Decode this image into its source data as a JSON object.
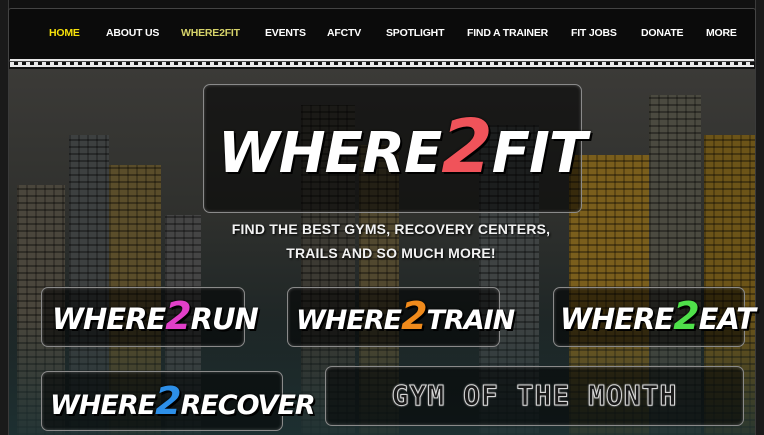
{
  "nav": {
    "items": [
      {
        "label": "HOME"
      },
      {
        "label": "ABOUT US"
      },
      {
        "label": "WHERE2FIT"
      },
      {
        "label": "EVENTS"
      },
      {
        "label": "AFCTV"
      },
      {
        "label": "SPOTLIGHT"
      },
      {
        "label": "FIND A TRAINER"
      },
      {
        "label": "FIT JOBS"
      },
      {
        "label": "DONATE"
      },
      {
        "label": "MORE"
      }
    ]
  },
  "hero": {
    "logo_prefix": "WHERE",
    "logo_num": "2",
    "logo_suffix": "FIT",
    "logo_num_color": "#f0535a",
    "tagline_line1": "FIND THE BEST GYMS, RECOVERY CENTERS,",
    "tagline_line2": "TRAILS AND SO MUCH MORE!"
  },
  "tiles": {
    "run": {
      "prefix": "WHERE",
      "num": "2",
      "suffix": "RUN",
      "num_color": "#e23fc9"
    },
    "train": {
      "prefix": "WHERE",
      "num": "2",
      "suffix": "TRAIN",
      "num_color": "#f08b1c"
    },
    "eat": {
      "prefix": "WHERE",
      "num": "2",
      "suffix": "EAT",
      "num_color": "#4fe04a"
    },
    "recover": {
      "prefix": "WHERE",
      "num": "2",
      "suffix": "RECOVER",
      "num_color": "#2d8fe8"
    },
    "gym_month": {
      "label": "GYM OF THE MONTH"
    }
  }
}
